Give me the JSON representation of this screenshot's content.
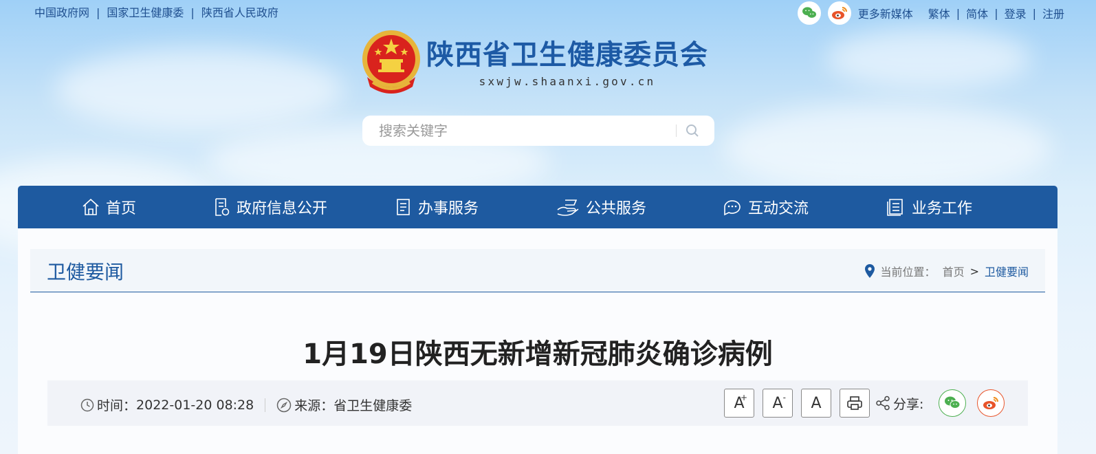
{
  "top_links": [
    "中国政府网",
    "国家卫生健康委",
    "陕西省人民政府"
  ],
  "top_right": {
    "more_media": "更多新媒体",
    "links": [
      "繁体",
      "简体",
      "登录",
      "注册"
    ]
  },
  "logo": {
    "title": "陕西省卫生健康委员会",
    "url": "sxwjw.shaanxi.gov.cn"
  },
  "search": {
    "placeholder": "搜索关键字"
  },
  "nav": [
    {
      "label": "首页",
      "icon": "home-icon"
    },
    {
      "label": "政府信息公开",
      "icon": "document-icon"
    },
    {
      "label": "办事服务",
      "icon": "clipboard-icon"
    },
    {
      "label": "公共服务",
      "icon": "hand-icon"
    },
    {
      "label": "互动交流",
      "icon": "chat-icon"
    },
    {
      "label": "业务工作",
      "icon": "book-icon"
    }
  ],
  "breadcrumb": {
    "section_title": "卫健要闻",
    "label": "当前位置：",
    "home": "首页",
    "separator": ">",
    "current": "卫健要闻"
  },
  "article": {
    "title": "1月19日陕西无新增新冠肺炎确诊病例",
    "time_label": "时间：",
    "time": "2022-01-20 08:28",
    "source_label": "来源：",
    "source": "省卫生健康委"
  },
  "tools": {
    "font_larger": "A",
    "font_larger_sup": "+",
    "font_smaller": "A",
    "font_smaller_sup": "-",
    "font_default": "A",
    "share_label": "分享:"
  },
  "colors": {
    "primary": "#1e5aa0",
    "wechat": "#4caf50",
    "weibo": "#e8542a"
  }
}
